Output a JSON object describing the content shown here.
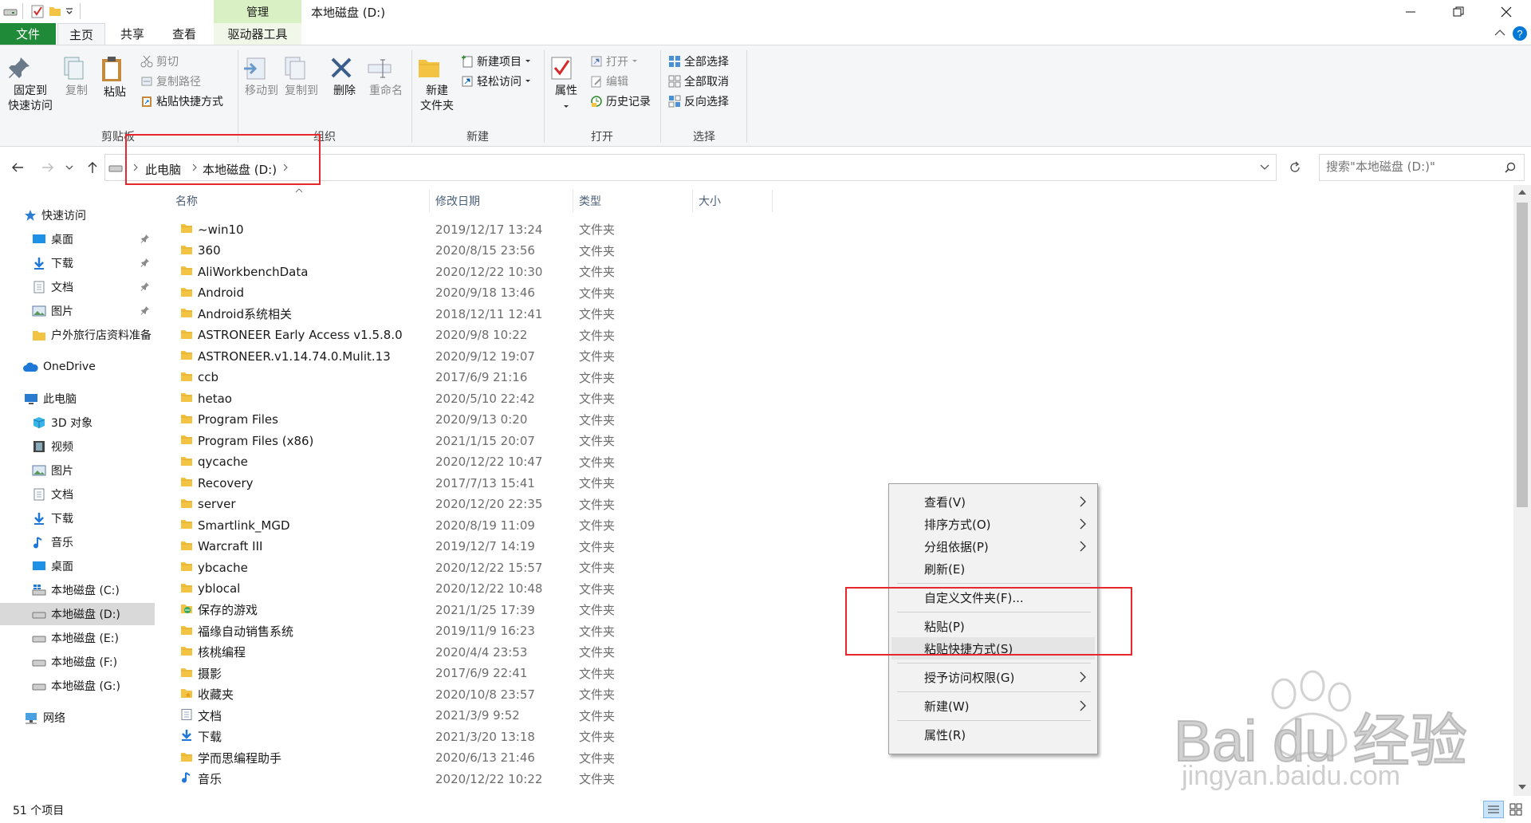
{
  "titlebar": {
    "context_tab": "管理",
    "window_title": "本地磁盘 (D:)"
  },
  "tabs": {
    "file": "文件",
    "home": "主页",
    "share": "共享",
    "view": "查看",
    "drive_tools": "驱动器工具"
  },
  "ribbon": {
    "clipboard": {
      "pin_line1": "固定到",
      "pin_line2": "快速访问",
      "copy": "复制",
      "paste": "粘贴",
      "cut": "剪切",
      "copy_path": "复制路径",
      "paste_shortcut": "粘贴快捷方式",
      "label": "剪贴板"
    },
    "organize": {
      "move_to": "移动到",
      "copy_to": "复制到",
      "delete": "删除",
      "rename": "重命名",
      "label": "组织"
    },
    "new": {
      "new_folder_line1": "新建",
      "new_folder_line2": "文件夹",
      "new_item": "新建项目",
      "easy_access": "轻松访问",
      "label": "新建"
    },
    "open": {
      "properties": "属性",
      "open": "打开",
      "edit": "编辑",
      "history": "历史记录",
      "label": "打开"
    },
    "select": {
      "select_all": "全部选择",
      "select_none": "全部取消",
      "invert": "反向选择",
      "label": "选择"
    }
  },
  "address": {
    "crumbs": [
      "此电脑",
      "本地磁盘 (D:)"
    ],
    "search_placeholder": "搜索\"本地磁盘 (D:)\""
  },
  "sidebar": {
    "quick_access": "快速访问",
    "quick_items": [
      "桌面",
      "下载",
      "文档",
      "图片",
      "户外旅行店资料准备"
    ],
    "onedrive": "OneDrive",
    "this_pc": "此电脑",
    "pc_items": [
      "3D 对象",
      "视频",
      "图片",
      "文档",
      "下载",
      "音乐",
      "桌面",
      "本地磁盘 (C:)",
      "本地磁盘 (D:)",
      "本地磁盘 (E:)",
      "本地磁盘 (F:)",
      "本地磁盘 (G:)"
    ],
    "network": "网络"
  },
  "columns": {
    "name": "名称",
    "date": "修改日期",
    "type": "类型",
    "size": "大小"
  },
  "files": [
    {
      "name": "~win10",
      "date": "2019/12/17 13:24",
      "type": "文件夹",
      "icon": "folder-icon"
    },
    {
      "name": "360",
      "date": "2020/8/15 23:56",
      "type": "文件夹",
      "icon": "folder-icon"
    },
    {
      "name": "AliWorkbenchData",
      "date": "2020/12/22 10:30",
      "type": "文件夹",
      "icon": "folder-icon"
    },
    {
      "name": "Android",
      "date": "2020/9/18 13:46",
      "type": "文件夹",
      "icon": "folder-icon"
    },
    {
      "name": "Android系统相关",
      "date": "2018/12/11 12:41",
      "type": "文件夹",
      "icon": "folder-icon"
    },
    {
      "name": "ASTRONEER Early Access v1.5.8.0",
      "date": "2020/9/8 10:22",
      "type": "文件夹",
      "icon": "folder-icon"
    },
    {
      "name": "ASTRONEER.v1.14.74.0.Mulit.13",
      "date": "2020/9/12 19:07",
      "type": "文件夹",
      "icon": "folder-icon"
    },
    {
      "name": "ccb",
      "date": "2017/6/9 21:16",
      "type": "文件夹",
      "icon": "folder-icon"
    },
    {
      "name": "hetao",
      "date": "2020/5/10 22:42",
      "type": "文件夹",
      "icon": "folder-icon"
    },
    {
      "name": "Program Files",
      "date": "2020/9/13 0:20",
      "type": "文件夹",
      "icon": "folder-icon"
    },
    {
      "name": "Program Files (x86)",
      "date": "2021/1/15 20:07",
      "type": "文件夹",
      "icon": "folder-icon"
    },
    {
      "name": "qycache",
      "date": "2020/12/22 10:47",
      "type": "文件夹",
      "icon": "folder-icon"
    },
    {
      "name": "Recovery",
      "date": "2017/7/13 15:41",
      "type": "文件夹",
      "icon": "folder-icon"
    },
    {
      "name": "server",
      "date": "2020/12/20 22:35",
      "type": "文件夹",
      "icon": "folder-icon"
    },
    {
      "name": "Smartlink_MGD",
      "date": "2020/8/19 11:09",
      "type": "文件夹",
      "icon": "folder-icon"
    },
    {
      "name": "Warcraft III",
      "date": "2019/12/7 14:19",
      "type": "文件夹",
      "icon": "folder-icon"
    },
    {
      "name": "ybcache",
      "date": "2020/12/22 15:57",
      "type": "文件夹",
      "icon": "folder-icon"
    },
    {
      "name": "yblocal",
      "date": "2020/12/22 10:48",
      "type": "文件夹",
      "icon": "folder-icon"
    },
    {
      "name": "保存的游戏",
      "date": "2021/1/25 17:39",
      "type": "文件夹",
      "icon": "saved-games-icon"
    },
    {
      "name": "福缘自动销售系统",
      "date": "2019/11/9 16:23",
      "type": "文件夹",
      "icon": "folder-icon"
    },
    {
      "name": "核桃编程",
      "date": "2020/4/4 23:53",
      "type": "文件夹",
      "icon": "folder-icon"
    },
    {
      "name": "摄影",
      "date": "2017/6/9 22:41",
      "type": "文件夹",
      "icon": "folder-icon"
    },
    {
      "name": "收藏夹",
      "date": "2020/10/8 23:57",
      "type": "文件夹",
      "icon": "favorites-icon"
    },
    {
      "name": "文档",
      "date": "2021/3/9 9:52",
      "type": "文件夹",
      "icon": "documents-icon"
    },
    {
      "name": "下载",
      "date": "2021/3/20 13:18",
      "type": "文件夹",
      "icon": "download-icon"
    },
    {
      "name": "学而思编程助手",
      "date": "2020/6/13 21:46",
      "type": "文件夹",
      "icon": "folder-icon"
    },
    {
      "name": "音乐",
      "date": "2020/12/22 10:22",
      "type": "文件夹",
      "icon": "music-icon"
    }
  ],
  "status": {
    "count": "51 个项目"
  },
  "context_menu": {
    "view": "查看(V)",
    "sort": "排序方式(O)",
    "group": "分组依据(P)",
    "refresh": "刷新(E)",
    "customize": "自定义文件夹(F)...",
    "paste": "粘贴(P)",
    "paste_shortcut": "粘贴快捷方式(S)",
    "grant_access": "授予访问权限(G)",
    "new": "新建(W)",
    "properties": "属性(R)"
  },
  "watermark": {
    "brand": "Bai du 经验",
    "url": "jingyan.baidu.com"
  },
  "colors": {
    "file_tab": "#1f8a38",
    "accent": "#0078d7",
    "folder": "#f3c344",
    "highlight_box": "#e8262d"
  }
}
